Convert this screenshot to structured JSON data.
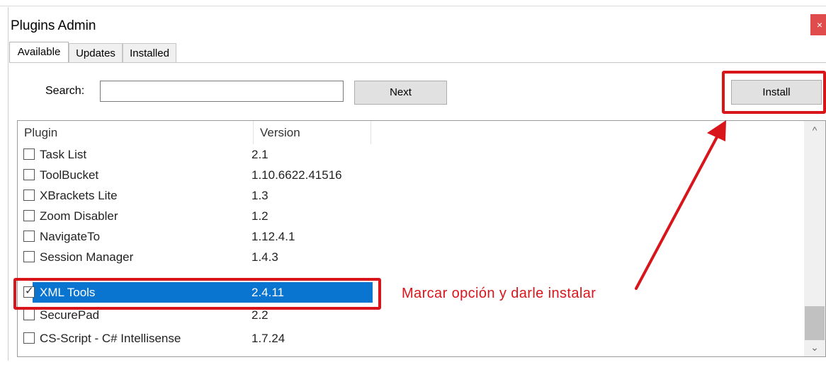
{
  "window": {
    "title": "Plugins Admin",
    "close_glyph": "×"
  },
  "tabs": [
    {
      "label": "Available",
      "active": true
    },
    {
      "label": "Updates",
      "active": false
    },
    {
      "label": "Installed",
      "active": false
    }
  ],
  "search": {
    "label": "Search:",
    "value": "",
    "placeholder": ""
  },
  "buttons": {
    "next": "Next",
    "install": "Install"
  },
  "table": {
    "columns": [
      "Plugin",
      "Version"
    ],
    "rows": [
      {
        "name": "Task List",
        "version": "2.1",
        "checked": false,
        "selected": false
      },
      {
        "name": "ToolBucket",
        "version": "1.10.6622.41516",
        "checked": false,
        "selected": false
      },
      {
        "name": "XBrackets Lite",
        "version": "1.3",
        "checked": false,
        "selected": false
      },
      {
        "name": "Zoom Disabler",
        "version": "1.2",
        "checked": false,
        "selected": false
      },
      {
        "name": "NavigateTo",
        "version": "1.12.4.1",
        "checked": false,
        "selected": false
      },
      {
        "name": "Session Manager",
        "version": "1.4.3",
        "checked": false,
        "selected": false
      },
      {
        "name": "XML Tools",
        "version": "2.4.11",
        "checked": true,
        "selected": true
      },
      {
        "name": "SecurePad",
        "version": "2.2",
        "checked": false,
        "selected": false
      },
      {
        "name": "CS-Script - C# Intellisense",
        "version": "1.7.24",
        "checked": false,
        "selected": false
      }
    ]
  },
  "scrollbar": {
    "up_glyph": "^",
    "down_glyph": "⌄"
  },
  "annotation": {
    "text": "Marcar opción y darle instalar",
    "color": "#d8151b"
  },
  "colors": {
    "selection": "#0a75d1",
    "close": "#e04b4b"
  }
}
